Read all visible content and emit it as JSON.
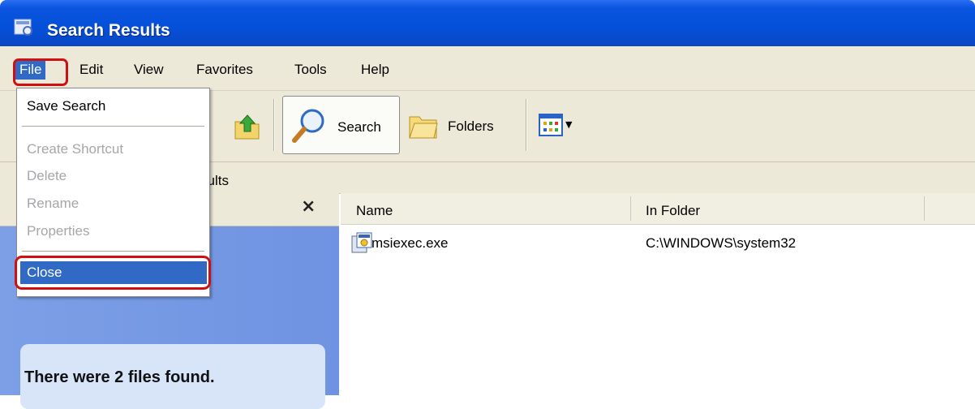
{
  "window": {
    "title": "Search Results"
  },
  "menubar": {
    "items": [
      "File",
      "Edit",
      "View",
      "Favorites",
      "Tools",
      "Help"
    ],
    "active": "File"
  },
  "toolbar": {
    "search_label": "Search",
    "folders_label": "Folders"
  },
  "addressbar": {
    "text_fragment": "sults"
  },
  "file_menu": {
    "items": [
      {
        "label": "Save Search",
        "enabled": true
      },
      {
        "label": "Create Shortcut",
        "enabled": false
      },
      {
        "label": "Delete",
        "enabled": false
      },
      {
        "label": "Rename",
        "enabled": false
      },
      {
        "label": "Properties",
        "enabled": false
      },
      {
        "label": "Close",
        "enabled": true,
        "highlighted": true
      }
    ]
  },
  "left_pane": {
    "close_glyph": "×",
    "info_text": "There were 2 files found."
  },
  "results": {
    "columns": [
      "Name",
      "In Folder"
    ],
    "rows": [
      {
        "name": "msiexec.exe",
        "folder": "C:\\WINDOWS\\system32"
      }
    ]
  },
  "colors": {
    "titlebar": "#0550d8",
    "menu_highlight": "#316ac5",
    "annotation": "#d01010"
  },
  "icons": [
    "search-results-icon",
    "up-folder-icon",
    "magnifier-icon",
    "folders-icon",
    "views-icon",
    "exe-file-icon"
  ]
}
